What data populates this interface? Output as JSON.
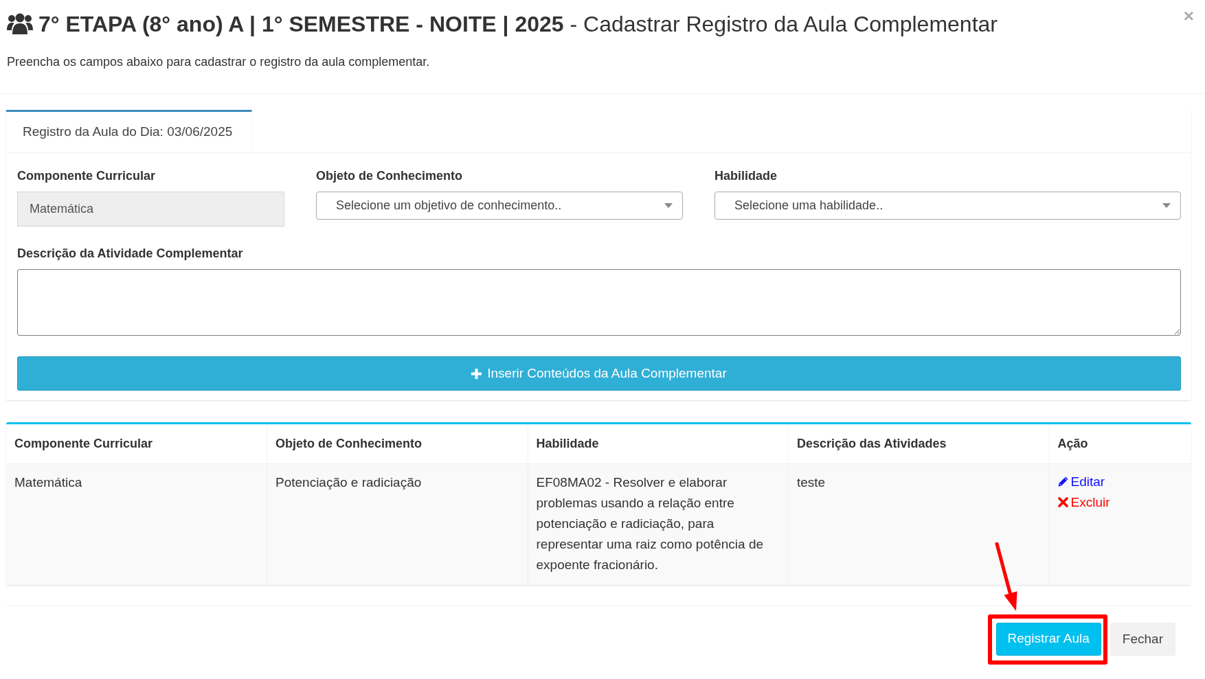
{
  "dialog": {
    "title": "**7° ETAPA (8° ano) A | 1° SEMESTRE - NOITE | 2025** - Cadastrar Registro da Aula Complementar",
    "close": "×",
    "subtitle": "Preencha os campos abaixo para cadastrar o registro da aula complementar."
  },
  "tabs": [
    {
      "label": "Registro da Aula do Dia: 03/06/2025",
      "selected": true
    }
  ],
  "form": {
    "fields": [
      {
        "kind": "readonly",
        "label": "Componente Curricular",
        "value": "Matemática"
      },
      {
        "kind": "select",
        "label": "Objeto de Conhecimento",
        "placeholder": "Selecione um objetivo de conhecimento.."
      },
      {
        "kind": "select",
        "label": "Habilidade",
        "placeholder": "Selecione uma habilidade.."
      },
      {
        "kind": "textarea",
        "label": "Descrição da Atividade Complementar"
      }
    ],
    "add_button": "Inserir Conteúdos da Aula Complementar"
  },
  "table": {
    "columns": [
      "Componente Curricular",
      "Objeto de Conhecimento",
      "Habilidade",
      "Descrição das Atividades",
      "Ação"
    ],
    "rows": [
      {
        "cells": [
          "Matemática",
          "Potenciação e radiciação",
          "EF08MA02 - Resolver e elaborar problemas usando a relação entre potenciação e radiciação, para representar uma raiz como potência de expoente fracionário.",
          "teste"
        ],
        "actions": [
          {
            "kind": "edit",
            "label": "Editar"
          },
          {
            "kind": "delete",
            "label": "Excluir"
          }
        ]
      }
    ]
  },
  "footer_buttons": [
    {
      "kind": "primary",
      "label": "Registrar Aula",
      "highlighted": true
    },
    {
      "kind": "default",
      "label": "Fechar",
      "highlighted": false
    }
  ]
}
